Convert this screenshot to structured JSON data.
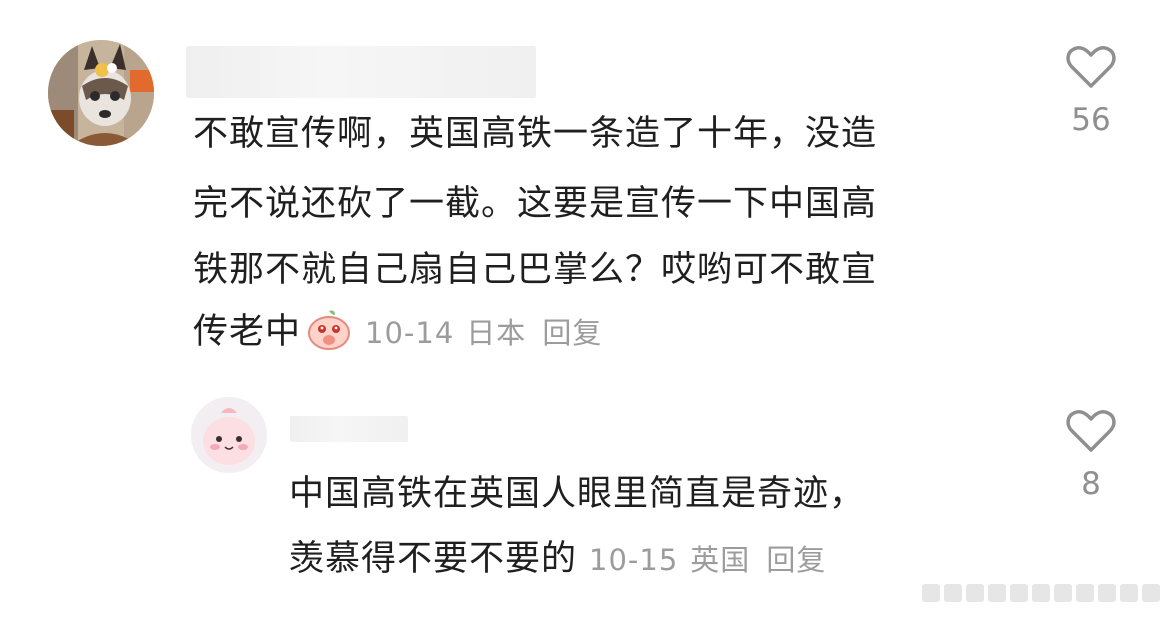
{
  "comments": [
    {
      "text_lines": [
        "不敢宣传啊，英国高铁一条造了十年，没造",
        "完不说还砍了一截。这要是宣传一下中国高",
        "铁那不就自己扇自己巴掌么？哎哟可不敢宣",
        "传老中"
      ],
      "date": "10-14",
      "location": "日本",
      "reply_label": "回复",
      "like_count": "56"
    },
    {
      "text_lines": [
        "中国高铁在英国人眼里简直是奇迹，",
        "羡慕得不要不要的"
      ],
      "date": "10-15",
      "location": "英国",
      "reply_label": "回复",
      "like_count": "8"
    }
  ],
  "icons": {
    "like": "heart-outline-icon",
    "emoji": "blushing-peach-emoji"
  },
  "colors": {
    "text": "#1f1f1f",
    "meta": "#9c9c9c",
    "icon": "#8f8f8f"
  }
}
